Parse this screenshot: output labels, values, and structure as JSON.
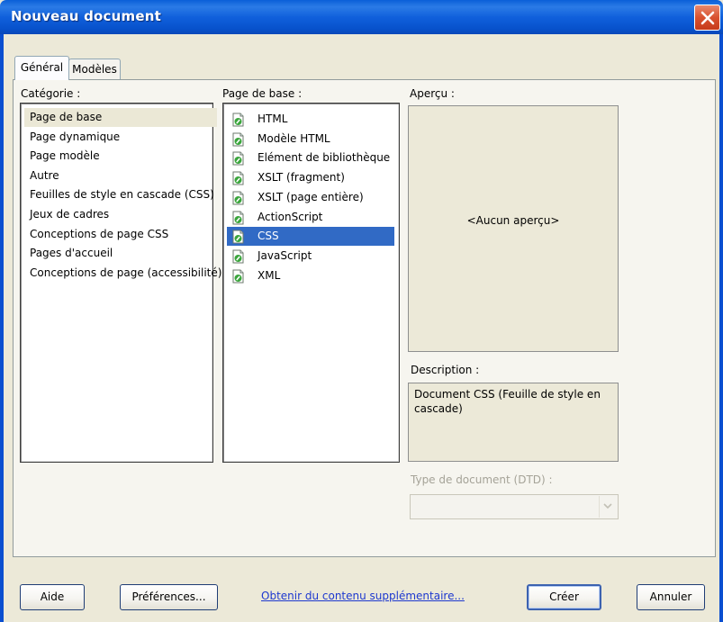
{
  "window": {
    "title": "Nouveau document"
  },
  "tabs": [
    {
      "label": "Général"
    },
    {
      "label": "Modèles"
    }
  ],
  "category": {
    "label": "Catégorie :",
    "items": [
      "Page de base",
      "Page dynamique",
      "Page modèle",
      "Autre",
      "Feuilles de style en cascade (CSS)",
      "Jeux de cadres",
      "Conceptions de page CSS",
      "Pages d'accueil",
      "Conceptions de page (accessibilité)"
    ],
    "selected": "Page de base"
  },
  "base_page": {
    "label": "Page de base :",
    "items": [
      "HTML",
      "Modèle HTML",
      "Elément de bibliothèque",
      "XSLT (fragment)",
      "XSLT (page entière)",
      "ActionScript",
      "CSS",
      "JavaScript",
      "XML"
    ],
    "selected": "CSS",
    "icon": "dreamweaver-document-icon"
  },
  "preview": {
    "label": "Aperçu :",
    "empty_text": "<Aucun aperçu>"
  },
  "description": {
    "label": "Description :",
    "text": "Document CSS (Feuille de style en cascade)"
  },
  "doctype": {
    "label": "Type de document (DTD) :",
    "value": ""
  },
  "footer": {
    "help": "Aide",
    "preferences": "Préférences...",
    "more_content": "Obtenir du contenu supplémentaire...",
    "create": "Créer",
    "cancel": "Annuler"
  },
  "colors": {
    "titlebar": "#0a5fd8",
    "selection": "#316ac5",
    "link": "#1d38cf",
    "dialog_bg": "#ece9d8"
  }
}
